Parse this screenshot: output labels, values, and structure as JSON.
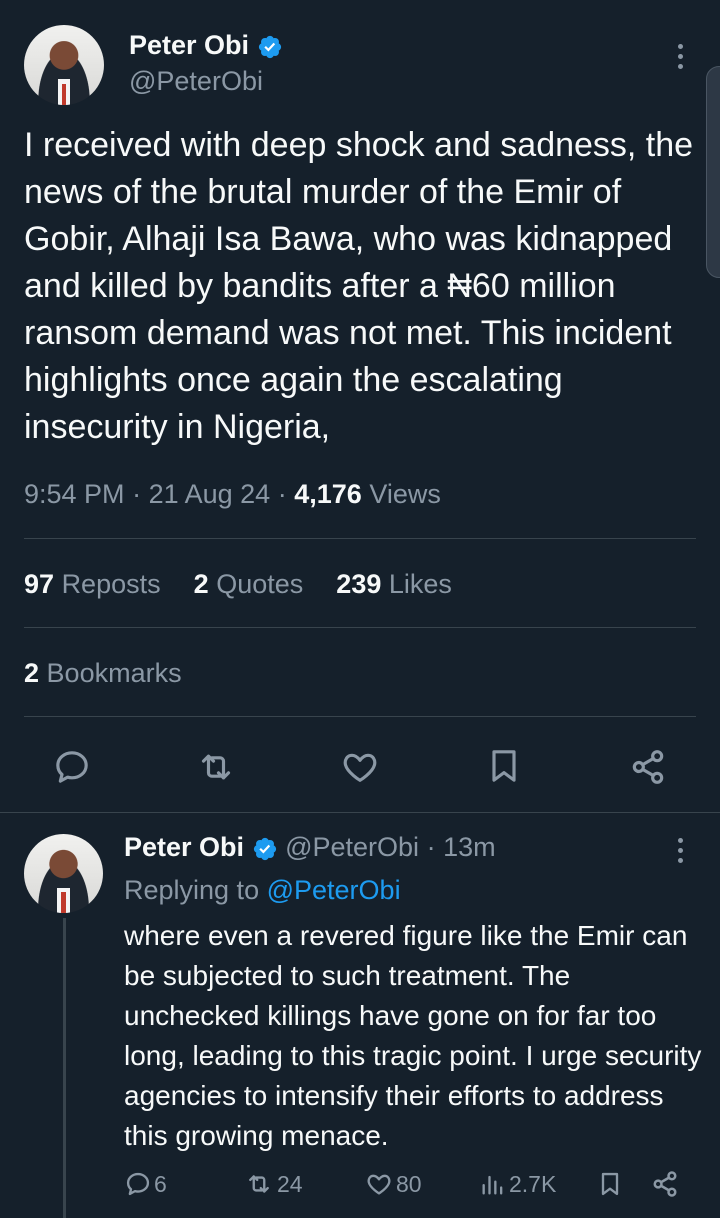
{
  "main_tweet": {
    "author_name": "Peter Obi",
    "handle": "@PeterObi",
    "text": "I received with deep shock and sadness, the news of the brutal murder of the Emir of Gobir, Alhaji Isa Bawa, who was kidnapped and killed by bandits after a ₦60 million ransom demand was not met. This incident highlights once again the escalating insecurity in Nigeria,",
    "time": "9:54 PM",
    "date": "21 Aug 24",
    "views_count": "4,176",
    "views_label": "Views",
    "reposts_count": "97",
    "reposts_label": "Reposts",
    "quotes_count": "2",
    "quotes_label": "Quotes",
    "likes_count": "239",
    "likes_label": "Likes",
    "bookmarks_count": "2",
    "bookmarks_label": "Bookmarks"
  },
  "reply_tweet": {
    "author_name": "Peter Obi",
    "handle": "@PeterObi",
    "age": "13m",
    "replying_to_prefix": "Replying to",
    "replying_to_handle": "@PeterObi",
    "text": "where even a revered figure like the Emir can be subjected to such treatment. The unchecked killings have gone on for far too long, leading to this tragic point. I urge security agencies to intensify their efforts to address this growing menace.",
    "replies": "6",
    "reposts": "24",
    "likes": "80",
    "views": "2.7K"
  },
  "colors": {
    "background": "#15202b",
    "text": "#f7f9f9",
    "muted": "#8b98a5",
    "accent": "#1d9bf0",
    "divider": "#38444d"
  },
  "icons": [
    "verified-badge-icon",
    "more-icon",
    "reply-icon",
    "repost-icon",
    "like-icon",
    "bookmark-icon",
    "share-icon",
    "views-icon"
  ]
}
